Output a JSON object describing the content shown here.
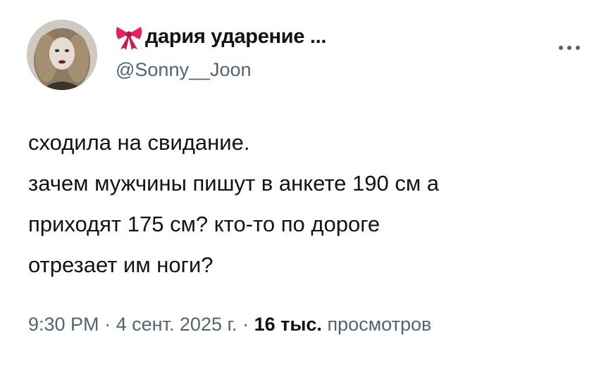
{
  "author": {
    "display_name": "дария ударение ...",
    "handle": "@Sonny__Joon",
    "name_emoji": "ribbon-bow-icon"
  },
  "more_icon": "more-horizontal-icon",
  "tweet": {
    "lines": [
      "сходила на свидание.",
      "зачем мужчины пишут в анкете 190 см а",
      "приходят 175 см? кто-то по дороге",
      "отрезает им ноги?"
    ]
  },
  "meta": {
    "time": "9:30 PM",
    "separator": "·",
    "date": "4 сент. 2025 г.",
    "views_count": "16 тыс.",
    "views_label": "просмотров"
  },
  "colors": {
    "text": "#0f1419",
    "secondary": "#536471",
    "bow": "#e0245e"
  }
}
